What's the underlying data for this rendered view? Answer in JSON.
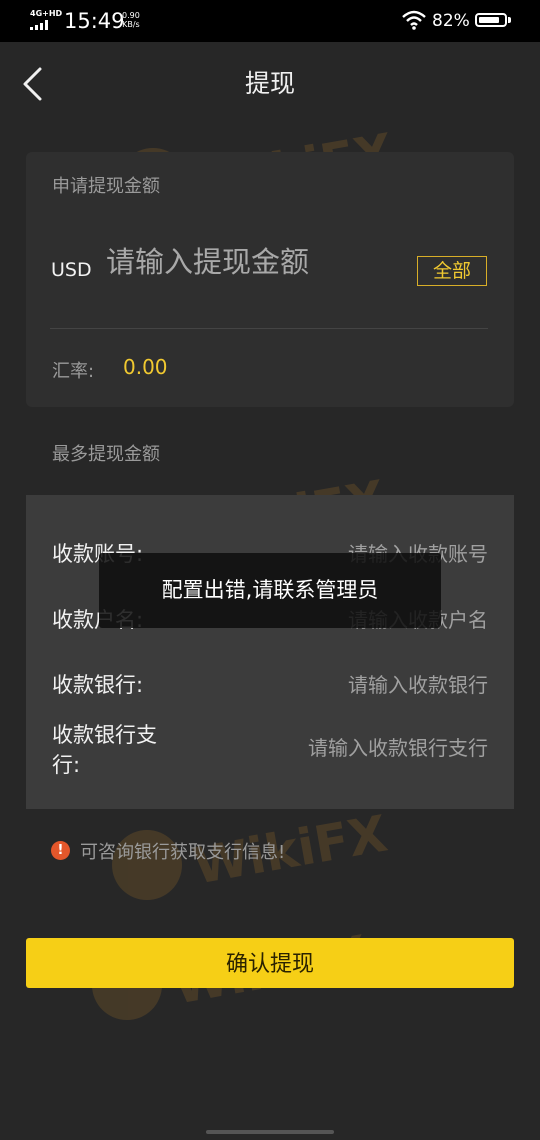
{
  "status_bar": {
    "network": "4G+HD",
    "time": "15:49",
    "speed_value": "0.90",
    "speed_unit": "KB/s",
    "battery": "82%",
    "battery_level": 0.82
  },
  "header": {
    "title": "提现"
  },
  "amount_card": {
    "label": "申请提现金额",
    "currency": "USD",
    "amount_placeholder": "请输入提现金额",
    "all_button": "全部",
    "rate_label": "汇率:",
    "rate_value": "0.00"
  },
  "max_label": "最多提现金额",
  "bank_form": {
    "rows": [
      {
        "label": "收款账号:",
        "placeholder": "请输入收款账号"
      },
      {
        "label": "收款户名:",
        "placeholder": "请输入收款户名"
      },
      {
        "label": "收款银行:",
        "placeholder": "请输入收款银行"
      },
      {
        "label": "收款银行支行:",
        "placeholder": "请输入收款银行支行"
      }
    ]
  },
  "toast": "配置出错,请联系管理员",
  "tip": {
    "icon": "!",
    "text": "可咨询银行获取支行信息!"
  },
  "confirm_button": "确认提现",
  "watermark": "WikiFX",
  "colors": {
    "accent": "#f6cf16",
    "background": "#272727",
    "card": "#2f2f2f",
    "warning": "#e4572b"
  }
}
